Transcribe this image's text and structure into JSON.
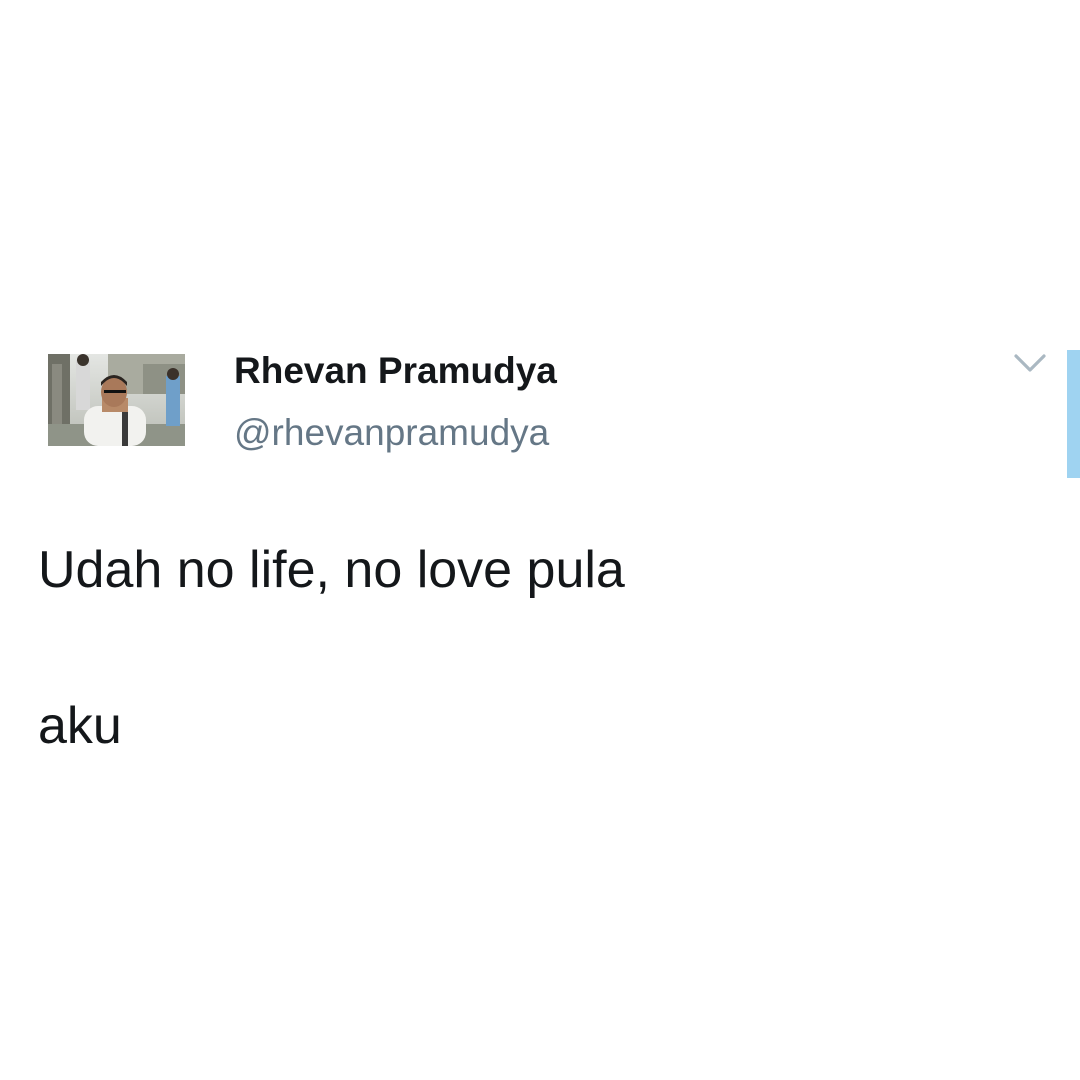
{
  "tweet": {
    "author": {
      "display_name": "Rhevan Pramudya",
      "handle": "@rhevanpramudya",
      "avatar": "profile-photo"
    },
    "menu_icon": "chevron-down-icon",
    "text_lines": [
      "Udah no life, no love pula",
      "aku"
    ]
  },
  "colors": {
    "name_text": "#14171a",
    "handle_text": "#657786",
    "caret": "#aab8c2",
    "side_bar": "#9fd3f1"
  }
}
